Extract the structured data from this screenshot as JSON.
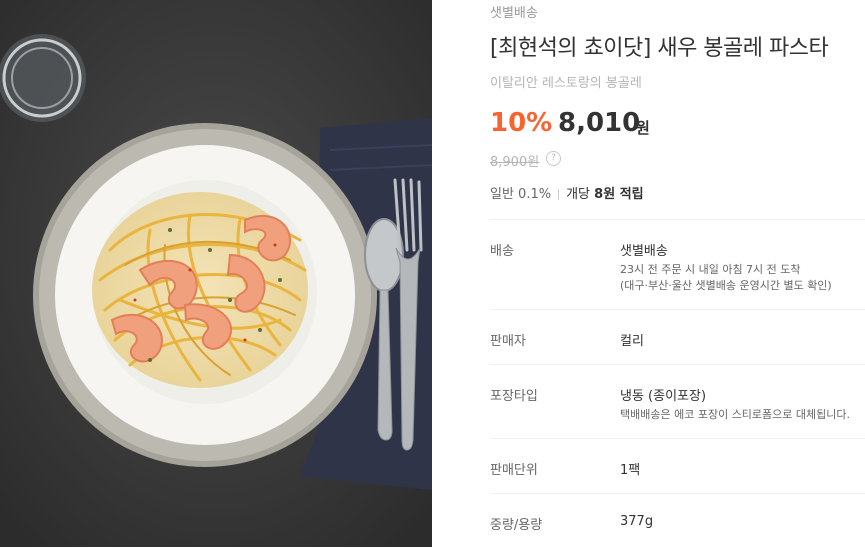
{
  "product": {
    "delivery_type": "샛별배송",
    "title": "[최현석의 쵸이닷] 새우 봉골레 파스타",
    "subtitle": "이탈리안 레스토랑의 봉골레",
    "discount": "10%",
    "price": "8,010",
    "currency": "원",
    "original_price": "8,900원",
    "help_glyph": "?",
    "points": {
      "grade": "일반 0.1%",
      "earn_text": "개당 ",
      "earn_amount": "8원 적립"
    }
  },
  "details": [
    {
      "label": "배송",
      "value": "샛별배송",
      "desc": [
        "23시 전 주문 시 내일 아침 7시 전 도착",
        "(대구·부산·울산 샛별배송 운영시간 별도 확인)"
      ]
    },
    {
      "label": "판매자",
      "value": "컬리"
    },
    {
      "label": "포장타입",
      "value": "냉동 (종이포장)",
      "desc": [
        "택배배송은 에코 포장이 스티로폼으로 대체됩니다."
      ]
    },
    {
      "label": "판매단위",
      "value": "1팩"
    },
    {
      "label": "중량/용량",
      "value": "377g"
    }
  ],
  "colors": {
    "accent": "#fa622f",
    "muted": "#b5b5b5",
    "text": "#333333"
  },
  "icons": [
    "help-icon"
  ]
}
